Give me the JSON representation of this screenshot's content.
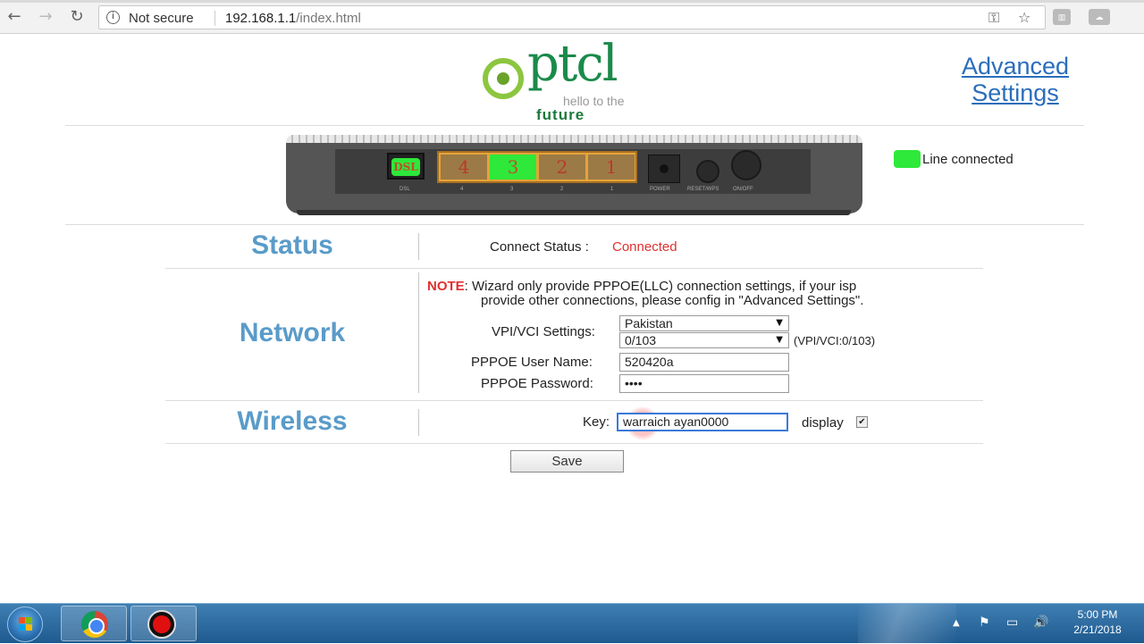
{
  "browser": {
    "security_label": "Not secure",
    "url_host": "192.168.1.1",
    "url_path": "/index.html"
  },
  "header": {
    "logo_text": "ptcl",
    "logo_tagline": "hello to the",
    "logo_tagline2": "future",
    "advanced_link_line1": "Advanced",
    "advanced_link_line2": "Settings"
  },
  "router": {
    "dsl_port": "DSL",
    "eth_ports": [
      "4",
      "3",
      "2",
      "1"
    ],
    "active_eth_port": "3",
    "port_labels": [
      "DSL",
      "4",
      "3",
      "2",
      "1",
      "POWER",
      "RESET/WPS",
      "ON/OFF"
    ],
    "line_status": "Line connected",
    "line_led_color": "#2ee83a"
  },
  "status": {
    "title": "Status",
    "connect_label": "Connect Status :",
    "connect_value": "Connected"
  },
  "network": {
    "title": "Network",
    "note_label": "NOTE",
    "note_line1": ": Wizard only provide PPPOE(LLC) connection settings, if your isp",
    "note_line2": "provide other connections, please config in \"Advanced Settings\".",
    "vpi_label": "VPI/VCI Settings:",
    "country_value": "Pakistan",
    "vpi_value": "0/103",
    "vpi_hint": "(VPI/VCI:0/103)",
    "username_label": "PPPOE User Name:",
    "username_value": "520420a",
    "password_label": "PPPOE Password:",
    "password_value": "••••"
  },
  "wireless": {
    "title": "Wireless",
    "key_label": "Key:",
    "key_value": "warraich ayan0000",
    "display_label": "display",
    "display_checked": true
  },
  "actions": {
    "save_label": "Save"
  },
  "taskbar": {
    "clock_time": "5:00 PM",
    "clock_date": "2/21/2018"
  }
}
